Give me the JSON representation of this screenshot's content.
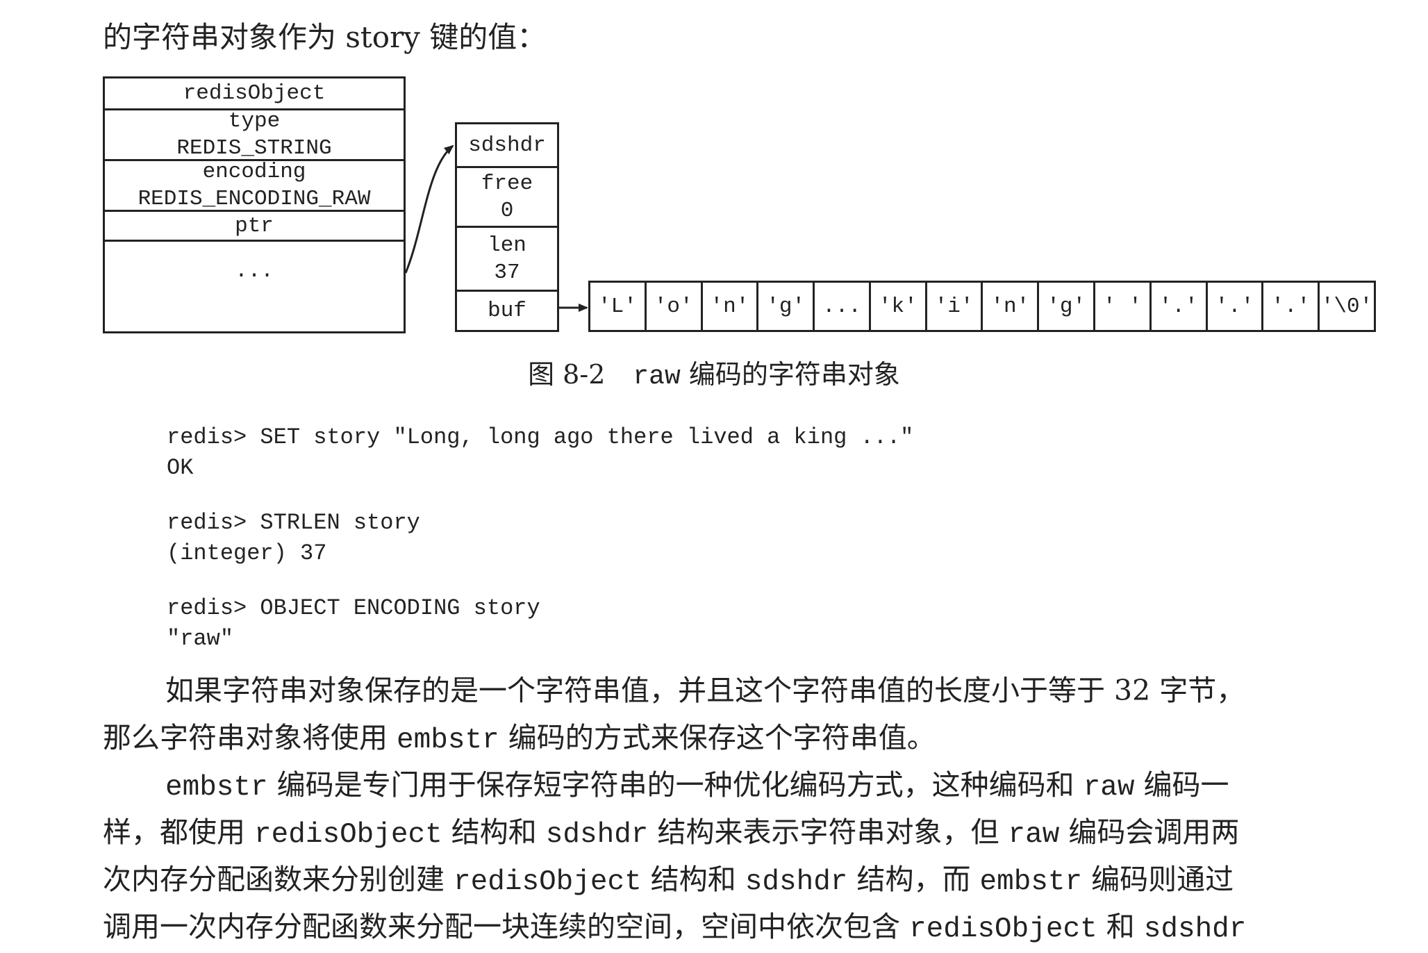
{
  "intro_text": "的字符串对象作为 story 键的值：",
  "diagram": {
    "redis_object": {
      "title": "redisObject",
      "type_label": "type",
      "type_value": "REDIS_STRING",
      "encoding_label": "encoding",
      "encoding_value": "REDIS_ENCODING_RAW",
      "ptr_label": "ptr",
      "more_label": "..."
    },
    "sdshdr": {
      "title": "sdshdr",
      "free_label": "free",
      "free_value": "0",
      "len_label": "len",
      "len_value": "37",
      "buf_label": "buf"
    },
    "buf_cells": [
      "'L'",
      "'o'",
      "'n'",
      "'g'",
      "...",
      "'k'",
      "'i'",
      "'n'",
      "'g'",
      "' '",
      "'.'",
      "'.'",
      "'.'",
      "'\\0'"
    ]
  },
  "figure_caption": {
    "number": "图 8-2",
    "code": "raw",
    "text": "编码的字符串对象"
  },
  "code_block": [
    [
      "redis> SET story \"Long, long ago there lived a king ...\"",
      "OK"
    ],
    [
      "redis> STRLEN story",
      "(integer) 37"
    ],
    [
      "redis> OBJECT ENCODING story",
      "\"raw\""
    ]
  ],
  "paragraph1": {
    "line1": "如果字符串对象保存的是一个字符串值，并且这个字符串值的长度小于等于 32 字节，",
    "line2_a": "那么字符串对象将使用 ",
    "line2_code": "embstr",
    "line2_b": " 编码的方式来保存这个字符串值。"
  },
  "paragraph2": {
    "l1_code1": "embstr",
    "l1_a": " 编码是专门用于保存短字符串的一种优化编码方式，这种编码和 ",
    "l1_code2": "raw",
    "l1_b": " 编码一",
    "l2_a": "样，都使用 ",
    "l2_code1": "redisObject",
    "l2_b": " 结构和 ",
    "l2_code2": "sdshdr",
    "l2_c": " 结构来表示字符串对象，但 ",
    "l2_code3": "raw",
    "l2_d": " 编码会调用两",
    "l3_a": "次内存分配函数来分别创建 ",
    "l3_code1": "redisObject",
    "l3_b": " 结构和 ",
    "l3_code2": "sdshdr",
    "l3_c": " 结构，而 ",
    "l3_code3": "embstr",
    "l3_d": " 编码则通过",
    "l4_a": "调用一次内存分配函数来分配一块连续的空间，空间中依次包含 ",
    "l4_code1": "redisObject",
    "l4_b": " 和 ",
    "l4_code2": "sdshdr"
  }
}
